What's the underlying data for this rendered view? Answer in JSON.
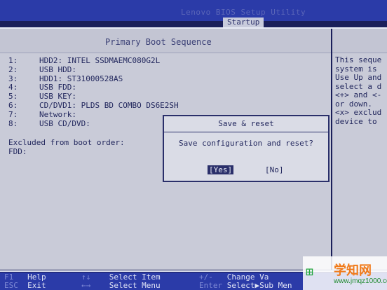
{
  "header": {
    "utility_title": "Lenovo BIOS Setup Utility",
    "active_tab": "Startup"
  },
  "boot_sequence": {
    "title": "Primary Boot Sequence",
    "items": [
      {
        "num": "1:",
        "label": "HDD2: INTEL SSDMAEMC080G2L"
      },
      {
        "num": "2:",
        "label": "USB HDD:"
      },
      {
        "num": "3:",
        "label": "HDD1: ST31000528AS"
      },
      {
        "num": "4:",
        "label": "USB FDD:"
      },
      {
        "num": "5:",
        "label": "USB KEY:"
      },
      {
        "num": "6:",
        "label": "CD/DVD1: PLDS  BD COMBO DS6E2SH"
      },
      {
        "num": "7:",
        "label": "Network:"
      },
      {
        "num": "8:",
        "label": "USB CD/DVD:"
      }
    ],
    "excluded_label": "Excluded from boot order:",
    "excluded_items": [
      "FDD:"
    ]
  },
  "help": {
    "lines": [
      "This seque",
      "system is",
      "Use Up and",
      "select a d",
      "<+> and <-",
      "or down.",
      "<x> exclud",
      "device to"
    ]
  },
  "dialog": {
    "title": "Save & reset",
    "message": "Save configuration and reset?",
    "yes_label": "[Yes]",
    "no_label": "[No]"
  },
  "footer": {
    "f1_key": "F1",
    "f1_label": "Help",
    "esc_key": "ESC",
    "esc_label": "Exit",
    "updown_key": "↑↓",
    "updown_label": "Select Item",
    "leftright_key": "←→",
    "leftright_label": "Select Menu",
    "plusminus_key": "+/-",
    "plusminus_label": "Change Va",
    "enter_key": "Enter",
    "enter_label": "Select▶Sub Men"
  },
  "watermark": {
    "site_name": "学知网",
    "url": "www.jmqz1000.com"
  }
}
